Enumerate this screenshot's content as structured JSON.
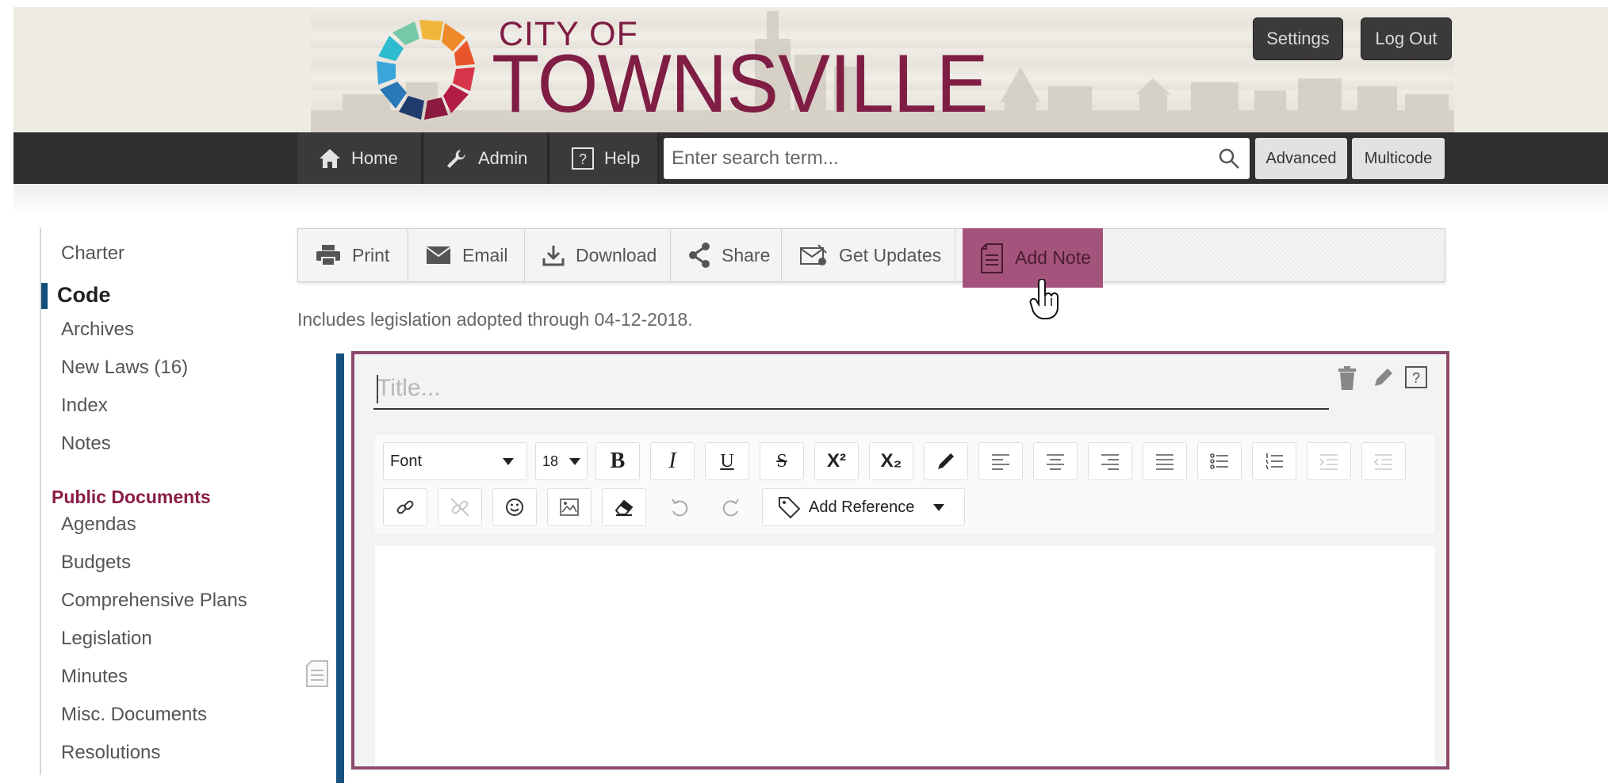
{
  "header": {
    "logo_city_of": "CITY OF",
    "logo_townsville": "TOWNSVILLE",
    "settings_label": "Settings",
    "logout_label": "Log Out",
    "brand_color": "#7f1d44"
  },
  "nav": {
    "home_label": "Home",
    "admin_label": "Admin",
    "help_label": "Help",
    "search_placeholder": "Enter search term...",
    "advanced_label": "Advanced",
    "multicode_label": "Multicode"
  },
  "sidebar": {
    "items": [
      {
        "label": "Charter"
      },
      {
        "label": "Code",
        "active": true
      },
      {
        "label": "Archives"
      },
      {
        "label": "New Laws (16)"
      },
      {
        "label": "Index"
      },
      {
        "label": "Notes"
      }
    ],
    "section_title": "Public Documents",
    "documents": [
      {
        "label": "Agendas"
      },
      {
        "label": "Budgets"
      },
      {
        "label": "Comprehensive Plans"
      },
      {
        "label": "Legislation"
      },
      {
        "label": "Minutes"
      },
      {
        "label": "Misc. Documents"
      },
      {
        "label": "Resolutions"
      }
    ]
  },
  "toolbar": {
    "print_label": "Print",
    "email_label": "Email",
    "download_label": "Download",
    "share_label": "Share",
    "updates_label": "Get Updates",
    "addnote_label": "Add Note",
    "addnote_color": "#a4547c"
  },
  "main": {
    "includes_text": "Includes legislation adopted through 04-12-2018."
  },
  "editor": {
    "title_placeholder": "Title...",
    "font_label": "Font",
    "size_label": "18",
    "add_reference_label": "Add Reference",
    "border_color": "#8c4a6d",
    "icons": [
      "bold-icon",
      "italic-icon",
      "underline-icon",
      "strikethrough-icon",
      "superscript-icon",
      "subscript-icon",
      "highlight-pen-icon",
      "align-left-icon",
      "align-center-icon",
      "align-right-icon",
      "justify-icon",
      "bulleted-list-icon",
      "numbered-list-icon",
      "indent-icon",
      "outdent-icon",
      "link-icon",
      "unlink-icon",
      "emoji-icon",
      "image-icon",
      "eraser-icon",
      "undo-icon",
      "redo-icon",
      "tag-icon"
    ]
  }
}
